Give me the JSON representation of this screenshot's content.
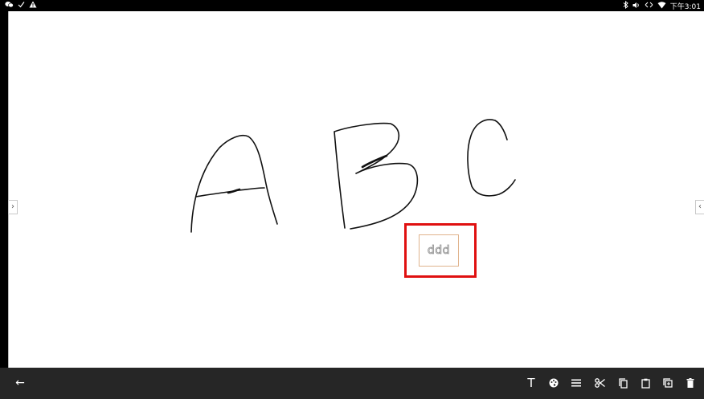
{
  "status_bar": {
    "left_icons": [
      "wechat-icon",
      "check-icon",
      "warning-icon"
    ],
    "right_icons": [
      "bluetooth-icon",
      "volume-icon",
      "data-icon",
      "wifi-icon"
    ],
    "time": "下午3:01"
  },
  "canvas": {
    "handwriting": [
      "A",
      "B",
      "C"
    ],
    "text_box": {
      "value": "ddd"
    },
    "left_nav": "›",
    "right_nav": "‹"
  },
  "toolbar": {
    "back": "←",
    "text_tool": "T",
    "tools": [
      "palette-icon",
      "menu-icon",
      "scissors-icon",
      "copy-icon",
      "paste-icon",
      "duplicate-icon",
      "delete-icon"
    ]
  },
  "colors": {
    "highlight": "#e01010",
    "toolbar_bg": "#262626",
    "textbox_border": "#e0b48d"
  }
}
